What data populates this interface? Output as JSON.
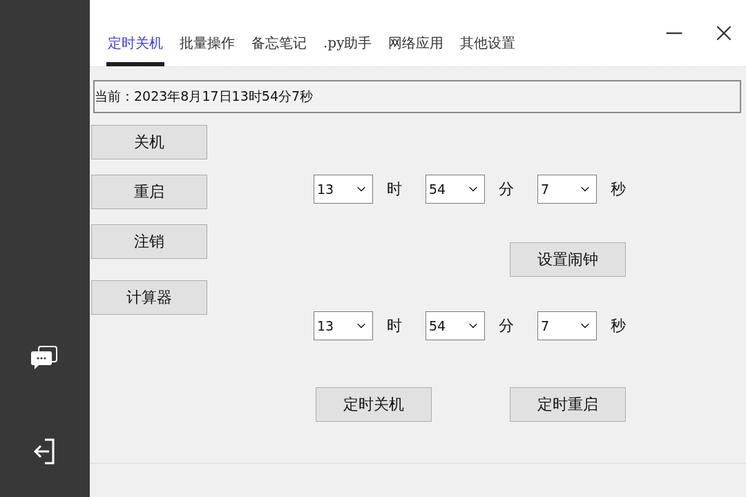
{
  "tabs": [
    {
      "label": "定时关机",
      "selected": true
    },
    {
      "label": "批量操作",
      "selected": false
    },
    {
      "label": "备忘笔记",
      "selected": false
    },
    {
      "label": ".py助手",
      "selected": false
    },
    {
      "label": "网络应用",
      "selected": false
    },
    {
      "label": "其他设置",
      "selected": false
    }
  ],
  "current_time": "当前：2023年8月17日13时54分7秒",
  "side_buttons": [
    "关机",
    "重启",
    "注销",
    "计算器"
  ],
  "alarm_time": [
    {
      "value": "13",
      "unit": "时"
    },
    {
      "value": "54",
      "unit": "分"
    },
    {
      "value": "7",
      "unit": "秒"
    }
  ],
  "alarm_button": "设置闹钟",
  "schedule_time": [
    {
      "value": "13",
      "unit": "时"
    },
    {
      "value": "54",
      "unit": "分"
    },
    {
      "value": "7",
      "unit": "秒"
    }
  ],
  "action_buttons": [
    "定时关机",
    "定时重启"
  ]
}
